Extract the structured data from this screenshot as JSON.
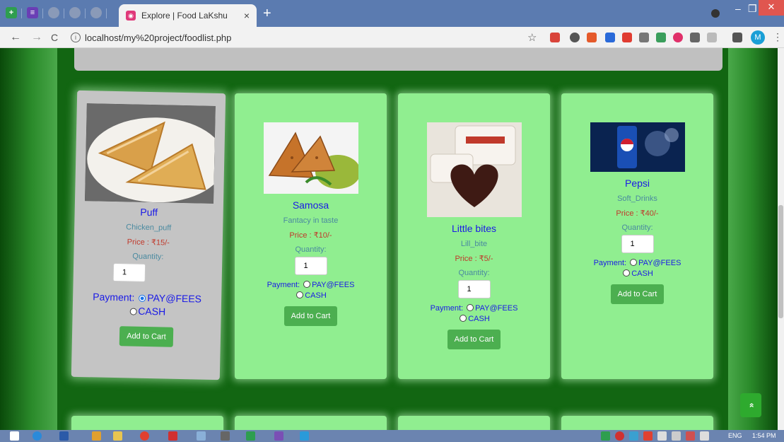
{
  "browser": {
    "tab_title": "Explore | Food LaKshu",
    "tab_close": "×",
    "new_tab": "+",
    "url": "localhost/my%20project/foodlist.php",
    "profile_initial": "M",
    "nav": {
      "back": "←",
      "forward": "→",
      "reload": "C"
    }
  },
  "foods": [
    {
      "name": "Puff",
      "category": "Chicken_puff",
      "price": "Price : ₹15/-",
      "quantity_label": "Quantity:",
      "quantity": "1",
      "payment_label": "Payment:",
      "option1": "PAY@FEES",
      "option2": "CASH",
      "selected": "PAY@FEES",
      "button": "Add to Cart"
    },
    {
      "name": "Samosa",
      "category": "Fantacy in taste",
      "price": "Price : ₹10/-",
      "quantity_label": "Quantity:",
      "quantity": "1",
      "payment_label": "Payment:",
      "option1": "PAY@FEES",
      "option2": "CASH",
      "selected": "",
      "button": "Add to Cart"
    },
    {
      "name": "Little bites",
      "category": "Lill_bite",
      "price": "Price : ₹5/-",
      "quantity_label": "Quantity:",
      "quantity": "1",
      "payment_label": "Payment:",
      "option1": "PAY@FEES",
      "option2": "CASH",
      "selected": "",
      "button": "Add to Cart"
    },
    {
      "name": "Pepsi",
      "category": "Soft_Drinks",
      "price": "Price : ₹40/-",
      "quantity_label": "Quantity:",
      "quantity": "1",
      "payment_label": "Payment:",
      "option1": "PAY@FEES",
      "option2": "CASH",
      "selected": "",
      "button": "Add to Cart"
    }
  ],
  "scroll_top_icon": "»",
  "taskbar": {
    "lang": "ENG",
    "time": "1:54 PM"
  }
}
